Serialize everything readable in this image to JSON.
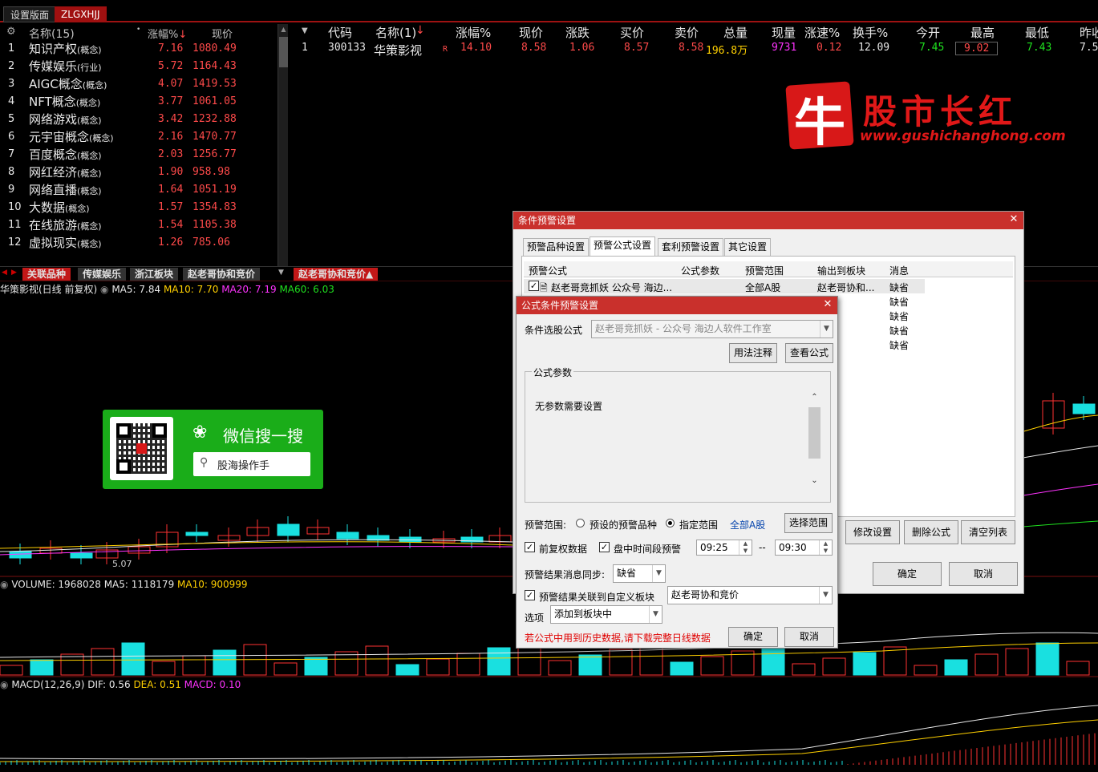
{
  "top_tabs": [
    "设置版面",
    "ZLGXHJJ"
  ],
  "sector_list": {
    "header": {
      "name": "名称(15)",
      "change": "涨幅%",
      "price": "现价"
    },
    "rows": [
      {
        "idx": "1",
        "name": "知识产权",
        "tag": "(概念)",
        "change": "7.16",
        "price": "1080.49"
      },
      {
        "idx": "2",
        "name": "传媒娱乐",
        "tag": "(行业)",
        "change": "5.72",
        "price": "1164.43"
      },
      {
        "idx": "3",
        "name": "AIGC概念",
        "tag": "(概念)",
        "change": "4.07",
        "price": "1419.53"
      },
      {
        "idx": "4",
        "name": "NFT概念",
        "tag": "(概念)",
        "change": "3.77",
        "price": "1061.05"
      },
      {
        "idx": "5",
        "name": "网络游戏",
        "tag": "(概念)",
        "change": "3.42",
        "price": "1232.88"
      },
      {
        "idx": "6",
        "name": "元宇宙概念",
        "tag": "(概念)",
        "change": "2.16",
        "price": "1470.77"
      },
      {
        "idx": "7",
        "name": "百度概念",
        "tag": "(概念)",
        "change": "2.03",
        "price": "1256.77"
      },
      {
        "idx": "8",
        "name": "网红经济",
        "tag": "(概念)",
        "change": "1.90",
        "price": "958.98"
      },
      {
        "idx": "9",
        "name": "网络直播",
        "tag": "(概念)",
        "change": "1.64",
        "price": "1051.19"
      },
      {
        "idx": "10",
        "name": "大数据",
        "tag": "(概念)",
        "change": "1.57",
        "price": "1354.83"
      },
      {
        "idx": "11",
        "name": "在线旅游",
        "tag": "(概念)",
        "change": "1.54",
        "price": "1105.38"
      },
      {
        "idx": "12",
        "name": "虚拟现实",
        "tag": "(概念)",
        "change": "1.26",
        "price": "785.06"
      }
    ]
  },
  "stock_table": {
    "headers": [
      "代码",
      "名称(1)",
      "涨幅%",
      "现价",
      "涨跌",
      "买价",
      "卖价",
      "总量",
      "现量",
      "涨速%",
      "换手%",
      "今开",
      "最高",
      "最低",
      "昨收"
    ],
    "row": {
      "idx": "1",
      "code": "300133",
      "name": "华策影视",
      "flag": "R",
      "change_pct": "14.10",
      "price": "8.58",
      "change": "1.06",
      "bid": "8.57",
      "ask": "8.58",
      "volume": "196.8万",
      "cur_vol": "9731",
      "speed": "0.12",
      "turnover": "12.09",
      "open": "7.45",
      "high": "9.02",
      "low": "7.43",
      "prev": "7.5"
    }
  },
  "bottom_tabs": [
    "关联品种",
    "传媒娱乐",
    "浙江板块",
    "赵老哥协和竞价",
    "赵老哥协和竞价▲"
  ],
  "chart_header": {
    "title": "华策影视(日线 前复权)",
    "ma5": "MA5: 7.84",
    "ma10": "MA10: 7.70",
    "ma20": "MA20: 7.19",
    "ma60": "MA60: 6.03",
    "low_mark": "5.07"
  },
  "volume_header": {
    "label": "VOLUME: 1968028",
    "ma5": "MA5: 1118179",
    "ma10": "MA10: 900999"
  },
  "macd_header": {
    "label": "MACD(12,26,9)",
    "dif": "DIF: 0.56",
    "dea": "DEA: 0.51",
    "macd": "MACD: 0.10"
  },
  "watermark": {
    "brand_char": "牛",
    "brand_text": "股市长红",
    "url": "www.gushichanghong.com"
  },
  "wechat_ad": {
    "title": "微信搜一搜",
    "search_text": "股海操作手"
  },
  "outer_dialog": {
    "title": "条件预警设置",
    "tabs": [
      "预警品种设置",
      "预警公式设置",
      "套利预警设置",
      "其它设置"
    ],
    "columns": [
      "预警公式",
      "公式参数",
      "预警范围",
      "输出到板块",
      "消息"
    ],
    "row1": {
      "formula": "赵老哥竞抓妖 公众号 海边...",
      "range": "全部A股",
      "output": "赵老哥协和...",
      "msg": "缺省"
    },
    "msgs": [
      "缺省",
      "缺省",
      "缺省",
      "缺省"
    ],
    "buttons": {
      "modify": "修改设置",
      "delete": "删除公式",
      "clear": "清空列表",
      "ok": "确定",
      "cancel": "取消"
    }
  },
  "inner_dialog": {
    "title": "公式条件预警设置",
    "formula_label": "条件选股公式",
    "formula_value": "赵老哥竞抓妖  -  公众号 海边人软件工作室",
    "usage_btn": "用法注释",
    "view_btn": "查看公式",
    "params_label": "公式参数",
    "params_text": "无参数需要设置",
    "range_label": "预警范围:",
    "range_opt1": "预设的预警品种",
    "range_opt2": "指定范围",
    "range_value": "全部A股",
    "select_range_btn": "选择范围",
    "adjusted_label": "前复权数据",
    "intraday_label": "盘中时间段预警",
    "time_start": "09:25",
    "time_sep": "--",
    "time_end": "09:30",
    "sync_label": "预警结果消息同步:",
    "sync_value": "缺省",
    "link_label": "预警结果关联到自定义板块",
    "link_value": "赵老哥协和竞价",
    "option_label": "选项",
    "option_value": "添加到板块中",
    "warning": "若公式中用到历史数据,请下载完整日线数据",
    "ok": "确定",
    "cancel": "取消"
  },
  "colors": {
    "red": "#ff4a4a",
    "green": "#1fe01f",
    "cyan": "#19e0e0",
    "yellow": "#ffd000",
    "magenta": "#ff33ff",
    "dialog_title": "#c9302c"
  }
}
